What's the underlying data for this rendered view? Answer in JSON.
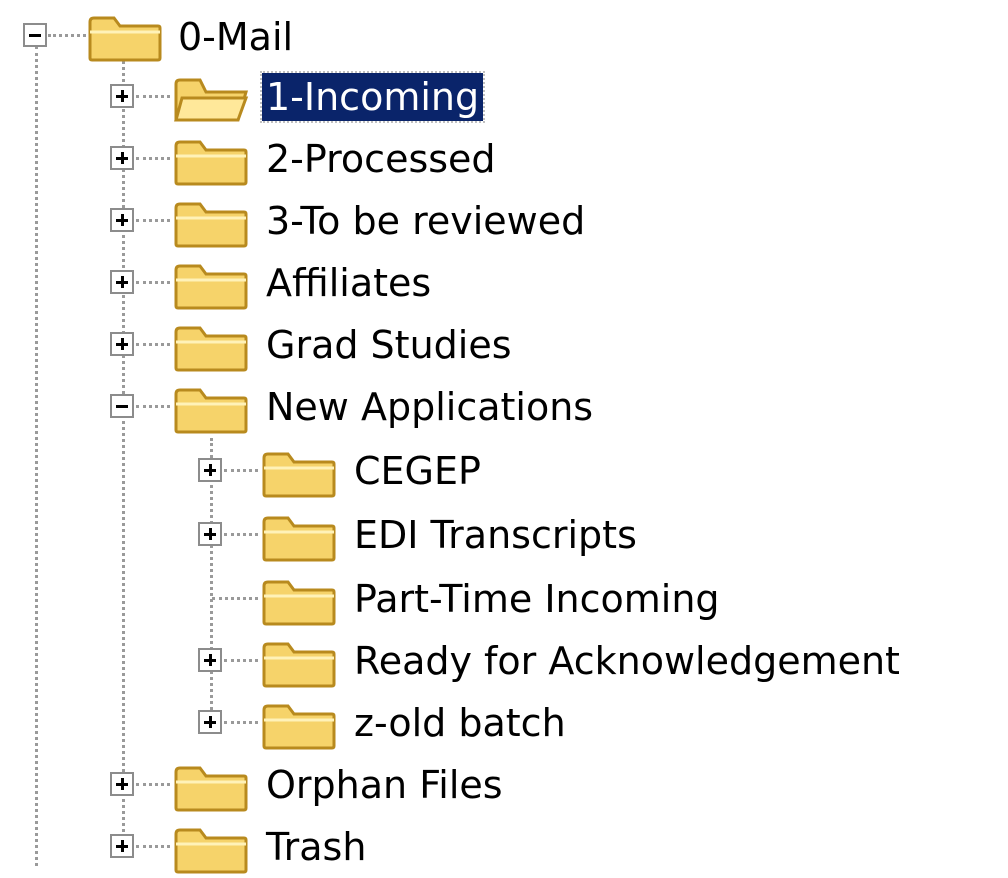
{
  "tree": {
    "root": {
      "label": "0-Mail",
      "expanded": true,
      "icon": "folder-icon"
    },
    "items": [
      {
        "label": "1-Incoming",
        "level": 1,
        "expander": "plus",
        "icon": "folder-open-icon",
        "selected": true
      },
      {
        "label": "2-Processed",
        "level": 1,
        "expander": "plus",
        "icon": "folder-icon"
      },
      {
        "label": "3-To be reviewed",
        "level": 1,
        "expander": "plus",
        "icon": "folder-icon"
      },
      {
        "label": "Affiliates",
        "level": 1,
        "expander": "plus",
        "icon": "folder-icon"
      },
      {
        "label": "Grad Studies",
        "level": 1,
        "expander": "plus",
        "icon": "folder-icon"
      },
      {
        "label": "New Applications",
        "level": 1,
        "expander": "minus",
        "icon": "folder-icon"
      },
      {
        "label": "CEGEP",
        "level": 2,
        "expander": "plus",
        "icon": "folder-icon"
      },
      {
        "label": "EDI Transcripts",
        "level": 2,
        "expander": "plus",
        "icon": "folder-icon"
      },
      {
        "label": "Part-Time Incoming",
        "level": 2,
        "expander": "none",
        "icon": "folder-icon"
      },
      {
        "label": "Ready for Acknowledgement",
        "level": 2,
        "expander": "plus",
        "icon": "folder-icon"
      },
      {
        "label": "z-old batch",
        "level": 2,
        "expander": "plus",
        "icon": "folder-icon"
      },
      {
        "label": "Orphan Files",
        "level": 1,
        "expander": "plus",
        "icon": "folder-icon"
      },
      {
        "label": "Trash",
        "level": 1,
        "expander": "plus",
        "icon": "folder-icon"
      }
    ]
  },
  "colors": {
    "selection_bg": "#0a246a",
    "selection_text": "#ffffff",
    "folder_fill": "#f6d36a",
    "folder_edge": "#b88a1e"
  }
}
